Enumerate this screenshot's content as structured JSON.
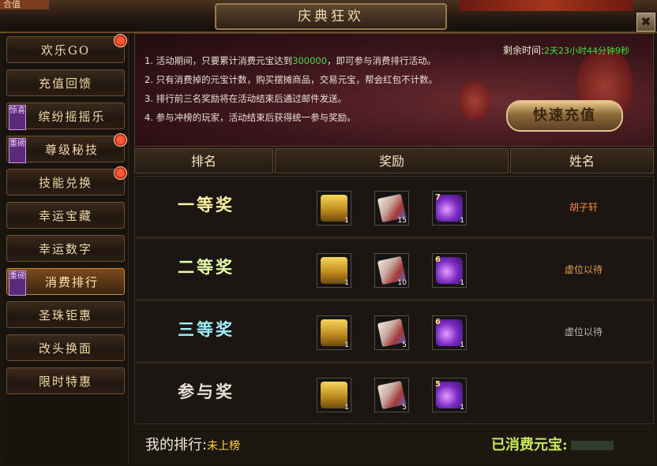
{
  "window": {
    "title": "庆典狂欢",
    "close_label": "✖",
    "top_left_fragment": "合值"
  },
  "sidebar": {
    "items": [
      {
        "label": "欢乐GO",
        "tag": "",
        "dot": true,
        "active": false
      },
      {
        "label": "充值回馈",
        "tag": "",
        "dot": false,
        "active": false
      },
      {
        "label": "缤纷摇摇乐",
        "tag": "惊喜",
        "dot": false,
        "active": false
      },
      {
        "label": "尊级秘技",
        "tag": "重磅",
        "dot": true,
        "active": false
      },
      {
        "label": "技能兑换",
        "tag": "",
        "dot": true,
        "active": false
      },
      {
        "label": "幸运宝藏",
        "tag": "",
        "dot": false,
        "active": false
      },
      {
        "label": "幸运数字",
        "tag": "",
        "dot": false,
        "active": false
      },
      {
        "label": "消费排行",
        "tag": "重磅",
        "dot": false,
        "active": true
      },
      {
        "label": "圣珠钜惠",
        "tag": "",
        "dot": false,
        "active": false
      },
      {
        "label": "改头换面",
        "tag": "",
        "dot": false,
        "active": false
      },
      {
        "label": "限时特惠",
        "tag": "",
        "dot": false,
        "active": false
      }
    ]
  },
  "banner": {
    "remain_label": "剩余时间:",
    "remain_value": "2天23小时44分钟9秒",
    "rules": [
      {
        "pre": "1. 活动期间，只要累计消费元宝达到",
        "hl": "300000",
        "post": "，即可参与消费排行活动。"
      },
      {
        "pre": "2. 只有消费掉的元宝计数，购买摆摊商品，交易元宝，帮会红包不计数。",
        "hl": "",
        "post": ""
      },
      {
        "pre": "3. 排行前三名奖励将在活动结束后通过邮件发送。",
        "hl": "",
        "post": ""
      },
      {
        "pre": "4. 参与冲榜的玩家，活动结束后获得统一参与奖励。",
        "hl": "",
        "post": ""
      }
    ],
    "recharge_label": "快速充值"
  },
  "table": {
    "headers": {
      "rank": "排名",
      "reward": "奖励",
      "name": "姓名"
    },
    "rows": [
      {
        "rank": "一等奖",
        "rank_color": "#fff2a0",
        "name": "胡子轩",
        "name_color": "#ff8a3a",
        "rewards": [
          {
            "type": "chest",
            "count": "1",
            "level": ""
          },
          {
            "type": "scroll",
            "count": "15",
            "level": ""
          },
          {
            "type": "gem",
            "count": "1",
            "level": "7"
          }
        ]
      },
      {
        "rank": "二等奖",
        "rank_color": "#e8ffb0",
        "name": "虚位以待",
        "name_color": "#e0a050",
        "rewards": [
          {
            "type": "chest",
            "count": "1",
            "level": ""
          },
          {
            "type": "scroll",
            "count": "10",
            "level": ""
          },
          {
            "type": "gem",
            "count": "1",
            "level": "6"
          }
        ]
      },
      {
        "rank": "三等奖",
        "rank_color": "#9ff0ff",
        "name": "虚位以待",
        "name_color": "#b8b8b8",
        "rewards": [
          {
            "type": "chest",
            "count": "1",
            "level": ""
          },
          {
            "type": "scroll",
            "count": "5",
            "level": ""
          },
          {
            "type": "gem",
            "count": "1",
            "level": "6"
          }
        ]
      },
      {
        "rank": "参与奖",
        "rank_color": "#e8e0d0",
        "name": "",
        "name_color": "#b8b8b8",
        "rewards": [
          {
            "type": "chest",
            "count": "1",
            "level": ""
          },
          {
            "type": "scroll",
            "count": "5",
            "level": ""
          },
          {
            "type": "gem",
            "count": "1",
            "level": "5"
          }
        ]
      }
    ]
  },
  "footer": {
    "my_rank_label": "我的排行:",
    "my_rank_value": "未上榜",
    "spent_label": "已消费元宝:"
  }
}
